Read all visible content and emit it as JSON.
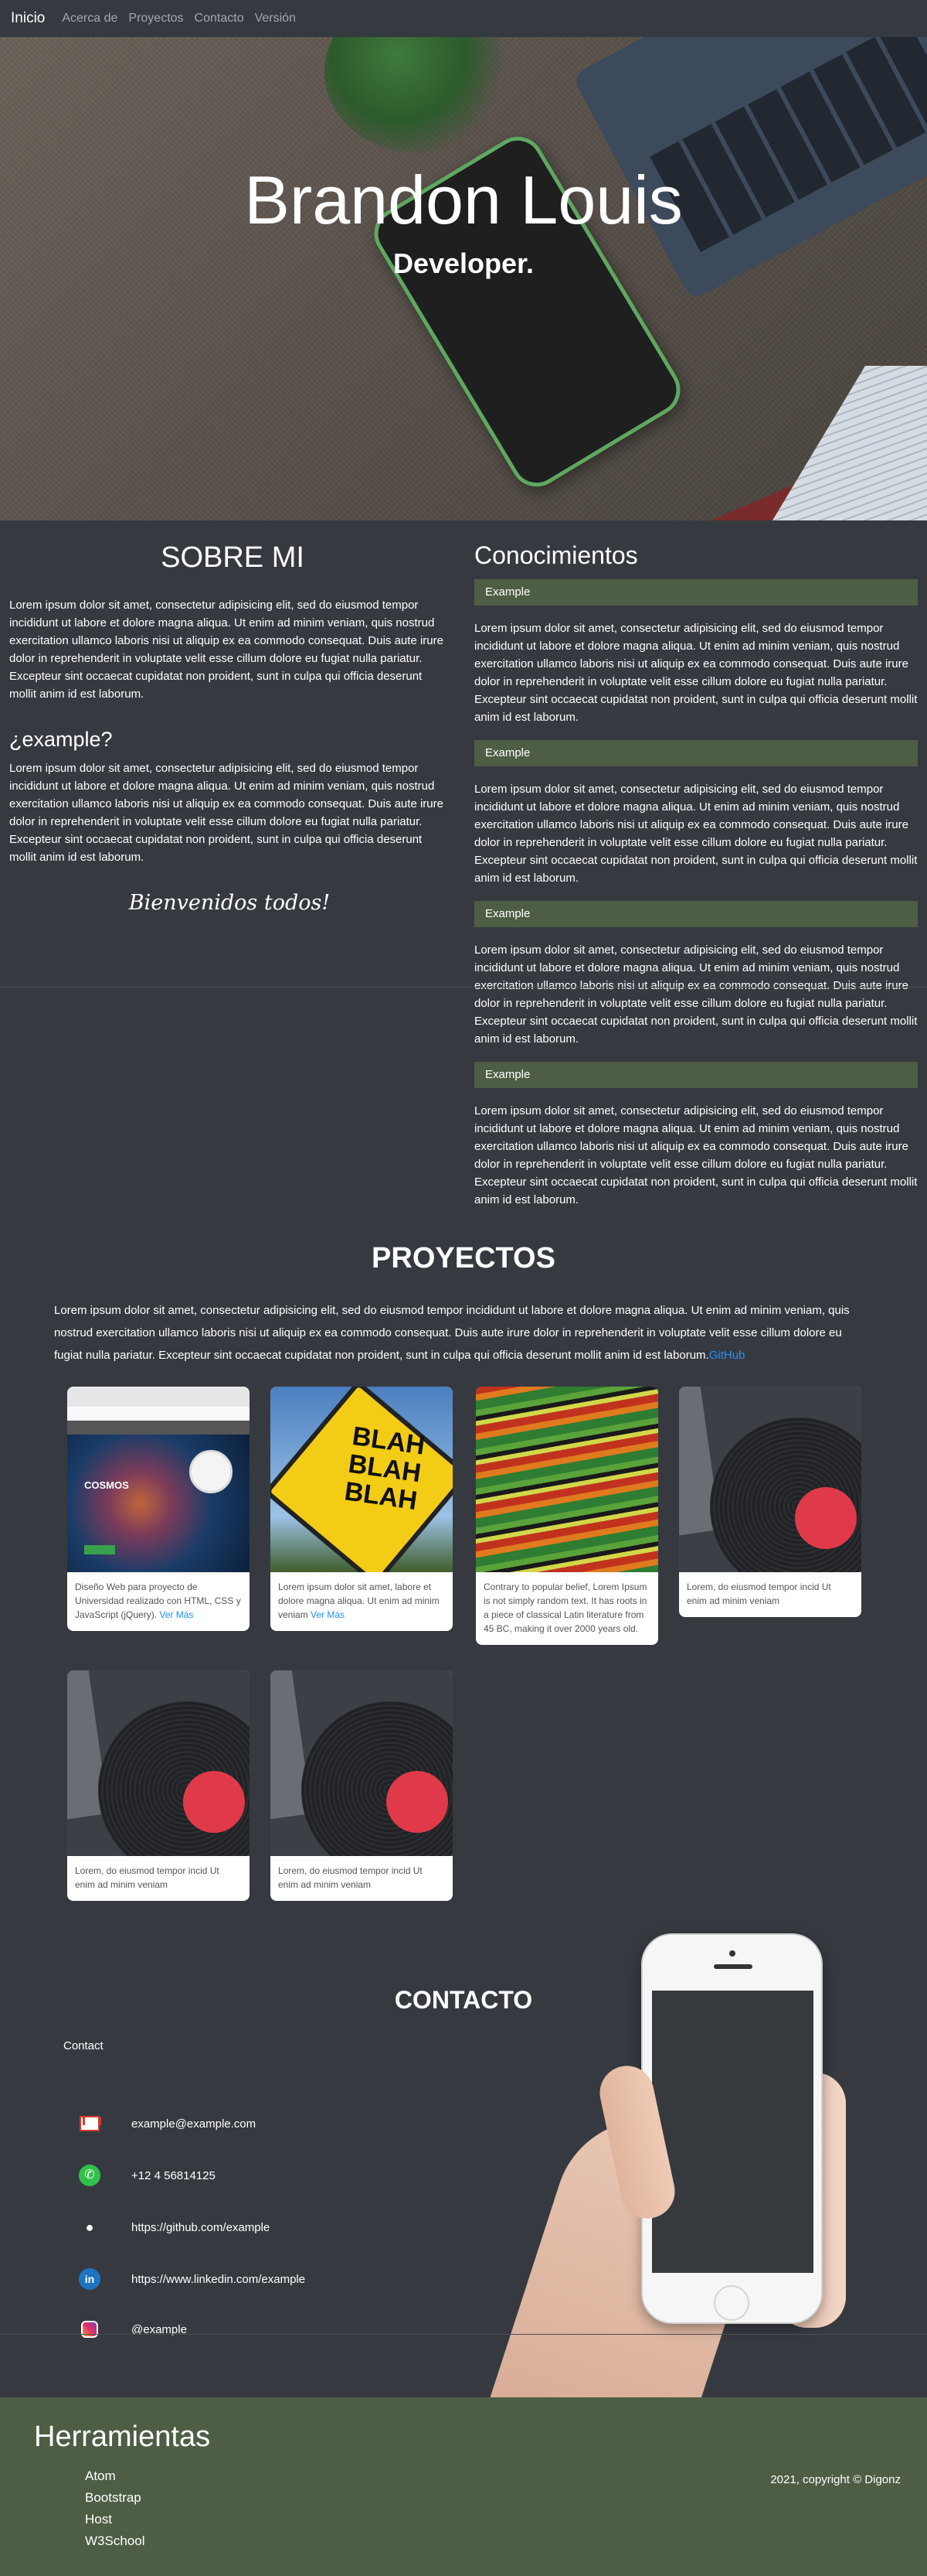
{
  "nav": {
    "brand": "Inicio",
    "links": [
      "Acerca de",
      "Proyectos",
      "Contacto",
      "Versión"
    ]
  },
  "hero": {
    "name": "Brandon Louis",
    "role": "Developer."
  },
  "about": {
    "title": "SOBRE MI",
    "p1": "Lorem ipsum dolor sit amet, consectetur adipisicing elit, sed do eiusmod tempor incididunt ut labore et dolore magna aliqua. Ut enim ad minim veniam, quis nostrud exercitation ullamco laboris nisi ut aliquip ex ea commodo consequat. Duis aute irure dolor in reprehenderit in voluptate velit esse cillum dolore eu fugiat nulla pariatur. Excepteur sint occaecat cupidatat non proident, sunt in culpa qui officia deserunt mollit anim id est laborum.",
    "subtitle": "¿example?",
    "p2": "Lorem ipsum dolor sit amet, consectetur adipisicing elit, sed do eiusmod tempor incididunt ut labore et dolore magna aliqua. Ut enim ad minim veniam, quis nostrud exercitation ullamco laboris nisi ut aliquip ex ea commodo consequat. Duis aute irure dolor in reprehenderit in voluptate velit esse cillum dolore eu fugiat nulla pariatur. Excepteur sint occaecat cupidatat non proident, sunt in culpa qui officia deserunt mollit anim id est laborum.",
    "welcome": "Bienvenidos todos!"
  },
  "skills": {
    "title": "Conocimientos",
    "items": [
      {
        "label": "Example",
        "text": "Lorem ipsum dolor sit amet, consectetur adipisicing elit, sed do eiusmod tempor incididunt ut labore et dolore magna aliqua. Ut enim ad minim veniam, quis nostrud exercitation ullamco laboris nisi ut aliquip ex ea commodo consequat. Duis aute irure dolor in reprehenderit in voluptate velit esse cillum dolore eu fugiat nulla pariatur. Excepteur sint occaecat cupidatat non proident, sunt in culpa qui officia deserunt mollit anim id est laborum."
      },
      {
        "label": "Example",
        "text": "Lorem ipsum dolor sit amet, consectetur adipisicing elit, sed do eiusmod tempor incididunt ut labore et dolore magna aliqua. Ut enim ad minim veniam, quis nostrud exercitation ullamco laboris nisi ut aliquip ex ea commodo consequat. Duis aute irure dolor in reprehenderit in voluptate velit esse cillum dolore eu fugiat nulla pariatur. Excepteur sint occaecat cupidatat non proident, sunt in culpa qui officia deserunt mollit anim id est laborum."
      },
      {
        "label": "Example",
        "text": "Lorem ipsum dolor sit amet, consectetur adipisicing elit, sed do eiusmod tempor incididunt ut labore et dolore magna aliqua. Ut enim ad minim veniam, quis nostrud exercitation ullamco laboris nisi ut aliquip ex ea commodo consequat. Duis aute irure dolor in reprehenderit in voluptate velit esse cillum dolore eu fugiat nulla pariatur. Excepteur sint occaecat cupidatat non proident, sunt in culpa qui officia deserunt mollit anim id est laborum."
      },
      {
        "label": "Example",
        "text": "Lorem ipsum dolor sit amet, consectetur adipisicing elit, sed do eiusmod tempor incididunt ut labore et dolore magna aliqua. Ut enim ad minim veniam, quis nostrud exercitation ullamco laboris nisi ut aliquip ex ea commodo consequat. Duis aute irure dolor in reprehenderit in voluptate velit esse cillum dolore eu fugiat nulla pariatur. Excepteur sint occaecat cupidatat non proident, sunt in culpa qui officia deserunt mollit anim id est laborum."
      }
    ]
  },
  "projects": {
    "title": "PROYECTOS",
    "intro": "Lorem ipsum dolor sit amet, consectetur adipisicing elit, sed do eiusmod tempor incididunt ut labore et dolore magna aliqua. Ut enim ad minim veniam, quis nostrud exercitation ullamco laboris nisi ut aliquip ex ea commodo consequat. Duis aute irure dolor in reprehenderit in voluptate velit esse cillum dolore eu fugiat nulla pariatur. Excepteur sint occaecat cupidatat non proident, sunt in culpa qui officia deserunt mollit anim id est laborum.",
    "intro_link": "GitHub",
    "cards": [
      {
        "text": "Diseño Web para proyecto de Universidad realizado con HTML, CSS y JavaScript (jQuery).",
        "more": "Ver Más",
        "cosmos_title": "COSMOS"
      },
      {
        "text": "Lorem ipsum dolor sit amet, labore et dolore magna aliqua. Ut enim ad minim veniam",
        "more": "Ver Más",
        "blah": "BLAH BLAH BLAH"
      },
      {
        "text": "Contrary to popular belief, Lorem Ipsum is not simply random text. It has roots in a piece of classical Latin literature from 45 BC, making it over 2000 years old.",
        "more": ""
      },
      {
        "text": "Lorem, do eiusmod tempor incid Ut enim ad minim veniam",
        "more": ""
      },
      {
        "text": "Lorem, do eiusmod tempor incid Ut enim ad minim veniam",
        "more": ""
      },
      {
        "text": "Lorem, do eiusmod tempor incid Ut enim ad minim veniam",
        "more": ""
      }
    ]
  },
  "contact": {
    "title": "CONTACTO",
    "subtitle": "Contact",
    "items": [
      {
        "icon": "gmail-icon",
        "text": "example@example.com"
      },
      {
        "icon": "whatsapp-icon",
        "text": "+12 4 56814125"
      },
      {
        "icon": "github-icon",
        "text": "https://github.com/example"
      },
      {
        "icon": "linkedin-icon",
        "text": "https://www.linkedin.com/example"
      },
      {
        "icon": "instagram-icon",
        "text": "@example"
      }
    ]
  },
  "footer": {
    "title": "Herramientas",
    "tools": [
      "Atom",
      "Bootstrap",
      "Host",
      "W3School"
    ],
    "copyright": "2021, copyright © Digonz"
  },
  "colors": {
    "background": "#363a40",
    "accent_green": "#4e5e45",
    "link_blue": "#1e90ff"
  }
}
